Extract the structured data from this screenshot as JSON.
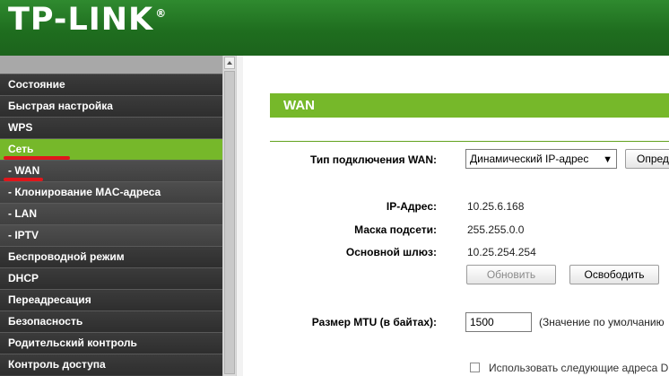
{
  "header": {
    "logo_text": "TP-LINK",
    "logo_mark": "®"
  },
  "sidebar": {
    "items": [
      {
        "label": "Состояние"
      },
      {
        "label": "Быстрая настройка"
      },
      {
        "label": "WPS"
      },
      {
        "label": "Сеть"
      },
      {
        "label": "- WAN"
      },
      {
        "label": "- Клонирование MAC-адреса"
      },
      {
        "label": "- LAN"
      },
      {
        "label": "- IPTV"
      },
      {
        "label": "Беспроводной режим"
      },
      {
        "label": "DHCP"
      },
      {
        "label": "Переадресация"
      },
      {
        "label": "Безопасность"
      },
      {
        "label": "Родительский контроль"
      },
      {
        "label": "Контроль доступа"
      }
    ]
  },
  "main": {
    "title": "WAN",
    "connection_type_label": "Тип подключения WAN:",
    "connection_type_value": "Динамический IP-адрес",
    "detect_button": "Определить",
    "ip_label": "IP-Адрес:",
    "ip_value": "10.25.6.168",
    "mask_label": "Маска подсети:",
    "mask_value": "255.255.0.0",
    "gateway_label": "Основной шлюз:",
    "gateway_value": "10.25.254.254",
    "renew_button": "Обновить",
    "release_button": "Освободить",
    "mtu_label": "Размер MTU (в байтах):",
    "mtu_value": "1500",
    "mtu_hint": "(Значение по умолчанию",
    "dns_checkbox_label": "Использовать следующие адреса D"
  },
  "colors": {
    "brand_green": "#1f6e1f",
    "accent_green": "#76b82a",
    "annotation_red": "#e0161b"
  }
}
